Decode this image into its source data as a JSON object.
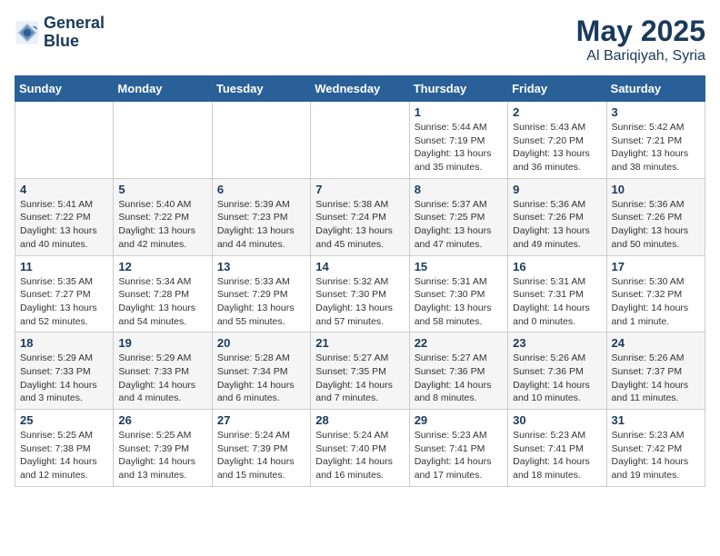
{
  "header": {
    "logo_line1": "General",
    "logo_line2": "Blue",
    "month_year": "May 2025",
    "location": "Al Bariqiyah, Syria"
  },
  "days_of_week": [
    "Sunday",
    "Monday",
    "Tuesday",
    "Wednesday",
    "Thursday",
    "Friday",
    "Saturday"
  ],
  "weeks": [
    [
      {
        "day": "",
        "content": ""
      },
      {
        "day": "",
        "content": ""
      },
      {
        "day": "",
        "content": ""
      },
      {
        "day": "",
        "content": ""
      },
      {
        "day": "1",
        "content": "Sunrise: 5:44 AM\nSunset: 7:19 PM\nDaylight: 13 hours and 35 minutes."
      },
      {
        "day": "2",
        "content": "Sunrise: 5:43 AM\nSunset: 7:20 PM\nDaylight: 13 hours and 36 minutes."
      },
      {
        "day": "3",
        "content": "Sunrise: 5:42 AM\nSunset: 7:21 PM\nDaylight: 13 hours and 38 minutes."
      }
    ],
    [
      {
        "day": "4",
        "content": "Sunrise: 5:41 AM\nSunset: 7:22 PM\nDaylight: 13 hours and 40 minutes."
      },
      {
        "day": "5",
        "content": "Sunrise: 5:40 AM\nSunset: 7:22 PM\nDaylight: 13 hours and 42 minutes."
      },
      {
        "day": "6",
        "content": "Sunrise: 5:39 AM\nSunset: 7:23 PM\nDaylight: 13 hours and 44 minutes."
      },
      {
        "day": "7",
        "content": "Sunrise: 5:38 AM\nSunset: 7:24 PM\nDaylight: 13 hours and 45 minutes."
      },
      {
        "day": "8",
        "content": "Sunrise: 5:37 AM\nSunset: 7:25 PM\nDaylight: 13 hours and 47 minutes."
      },
      {
        "day": "9",
        "content": "Sunrise: 5:36 AM\nSunset: 7:26 PM\nDaylight: 13 hours and 49 minutes."
      },
      {
        "day": "10",
        "content": "Sunrise: 5:36 AM\nSunset: 7:26 PM\nDaylight: 13 hours and 50 minutes."
      }
    ],
    [
      {
        "day": "11",
        "content": "Sunrise: 5:35 AM\nSunset: 7:27 PM\nDaylight: 13 hours and 52 minutes."
      },
      {
        "day": "12",
        "content": "Sunrise: 5:34 AM\nSunset: 7:28 PM\nDaylight: 13 hours and 54 minutes."
      },
      {
        "day": "13",
        "content": "Sunrise: 5:33 AM\nSunset: 7:29 PM\nDaylight: 13 hours and 55 minutes."
      },
      {
        "day": "14",
        "content": "Sunrise: 5:32 AM\nSunset: 7:30 PM\nDaylight: 13 hours and 57 minutes."
      },
      {
        "day": "15",
        "content": "Sunrise: 5:31 AM\nSunset: 7:30 PM\nDaylight: 13 hours and 58 minutes."
      },
      {
        "day": "16",
        "content": "Sunrise: 5:31 AM\nSunset: 7:31 PM\nDaylight: 14 hours and 0 minutes."
      },
      {
        "day": "17",
        "content": "Sunrise: 5:30 AM\nSunset: 7:32 PM\nDaylight: 14 hours and 1 minute."
      }
    ],
    [
      {
        "day": "18",
        "content": "Sunrise: 5:29 AM\nSunset: 7:33 PM\nDaylight: 14 hours and 3 minutes."
      },
      {
        "day": "19",
        "content": "Sunrise: 5:29 AM\nSunset: 7:33 PM\nDaylight: 14 hours and 4 minutes."
      },
      {
        "day": "20",
        "content": "Sunrise: 5:28 AM\nSunset: 7:34 PM\nDaylight: 14 hours and 6 minutes."
      },
      {
        "day": "21",
        "content": "Sunrise: 5:27 AM\nSunset: 7:35 PM\nDaylight: 14 hours and 7 minutes."
      },
      {
        "day": "22",
        "content": "Sunrise: 5:27 AM\nSunset: 7:36 PM\nDaylight: 14 hours and 8 minutes."
      },
      {
        "day": "23",
        "content": "Sunrise: 5:26 AM\nSunset: 7:36 PM\nDaylight: 14 hours and 10 minutes."
      },
      {
        "day": "24",
        "content": "Sunrise: 5:26 AM\nSunset: 7:37 PM\nDaylight: 14 hours and 11 minutes."
      }
    ],
    [
      {
        "day": "25",
        "content": "Sunrise: 5:25 AM\nSunset: 7:38 PM\nDaylight: 14 hours and 12 minutes."
      },
      {
        "day": "26",
        "content": "Sunrise: 5:25 AM\nSunset: 7:39 PM\nDaylight: 14 hours and 13 minutes."
      },
      {
        "day": "27",
        "content": "Sunrise: 5:24 AM\nSunset: 7:39 PM\nDaylight: 14 hours and 15 minutes."
      },
      {
        "day": "28",
        "content": "Sunrise: 5:24 AM\nSunset: 7:40 PM\nDaylight: 14 hours and 16 minutes."
      },
      {
        "day": "29",
        "content": "Sunrise: 5:23 AM\nSunset: 7:41 PM\nDaylight: 14 hours and 17 minutes."
      },
      {
        "day": "30",
        "content": "Sunrise: 5:23 AM\nSunset: 7:41 PM\nDaylight: 14 hours and 18 minutes."
      },
      {
        "day": "31",
        "content": "Sunrise: 5:23 AM\nSunset: 7:42 PM\nDaylight: 14 hours and 19 minutes."
      }
    ]
  ]
}
